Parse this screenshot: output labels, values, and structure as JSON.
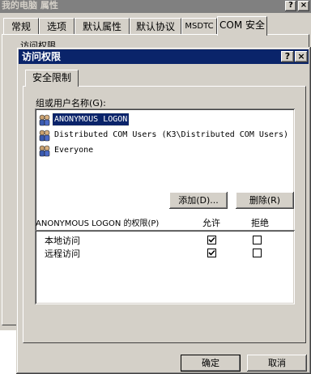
{
  "background_window": {
    "title": "我的电脑 属性",
    "title_buttons": {
      "help": "?",
      "close": "×"
    },
    "tabs": [
      {
        "label": "常规"
      },
      {
        "label": "选项"
      },
      {
        "label": "默认属性"
      },
      {
        "label": "默认协议"
      },
      {
        "label": "MSDTC"
      },
      {
        "label": "COM 安全",
        "active": true
      }
    ],
    "group_label": "访问权限"
  },
  "dialog": {
    "title": "访问权限",
    "title_buttons": {
      "help": "?",
      "close": "×"
    },
    "tab": "安全限制",
    "users_label": "组或用户名称(G):",
    "users": [
      {
        "name": "ANONYMOUS LOGON",
        "selected": true,
        "icon": "group-users-icon"
      },
      {
        "name": "Distributed COM Users (K3\\Distributed COM Users)",
        "selected": false,
        "icon": "group-users-icon"
      },
      {
        "name": "Everyone",
        "selected": false,
        "icon": "group-users-icon"
      }
    ],
    "add_button": "添加(D)...",
    "remove_button": "删除(R)",
    "permissions_label": "ANONYMOUS LOGON 的权限(P)",
    "allow_header": "允许",
    "deny_header": "拒绝",
    "permissions": [
      {
        "name": "本地访问",
        "allow": true,
        "deny": false
      },
      {
        "name": "远程访问",
        "allow": true,
        "deny": false
      }
    ],
    "ok_button": "确定",
    "cancel_button": "取消"
  }
}
